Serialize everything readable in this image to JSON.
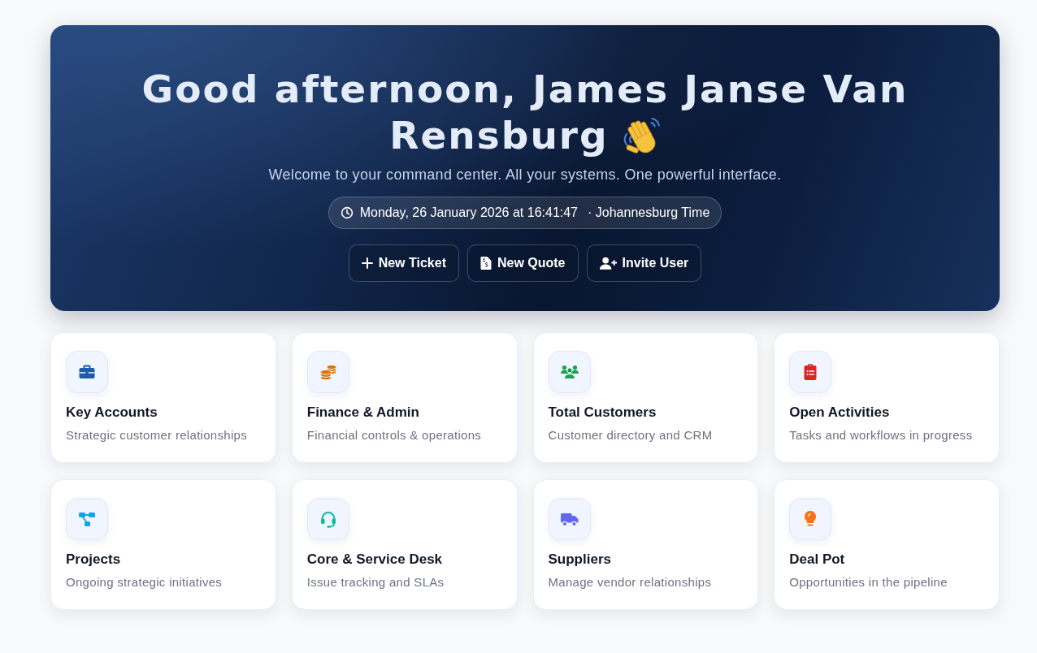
{
  "hero": {
    "greeting_lines": [
      "Good afternoon, James Janse Van",
      "Rensburg"
    ],
    "subtitle": "Welcome to your command center. All your systems. One powerful interface.",
    "datetime": "Monday, 26 January 2026 at 16:41:47",
    "timezone": "· Johannesburg Time",
    "actions": [
      {
        "label": "New Ticket"
      },
      {
        "label": "New Quote"
      },
      {
        "label": "Invite User"
      }
    ]
  },
  "cards": [
    {
      "title": "Key Accounts",
      "description": "Strategic customer relationships"
    },
    {
      "title": "Finance & Admin",
      "description": "Financial controls & operations"
    },
    {
      "title": "Total Customers",
      "description": "Customer directory and CRM"
    },
    {
      "title": "Open Activities",
      "description": "Tasks and workflows in progress"
    },
    {
      "title": "Projects",
      "description": "Ongoing strategic initiatives"
    },
    {
      "title": "Core & Service Desk",
      "description": "Issue tracking and SLAs"
    },
    {
      "title": "Suppliers",
      "description": "Manage vendor relationships"
    },
    {
      "title": "Deal Pot",
      "description": "Opportunities in the pipeline"
    }
  ]
}
